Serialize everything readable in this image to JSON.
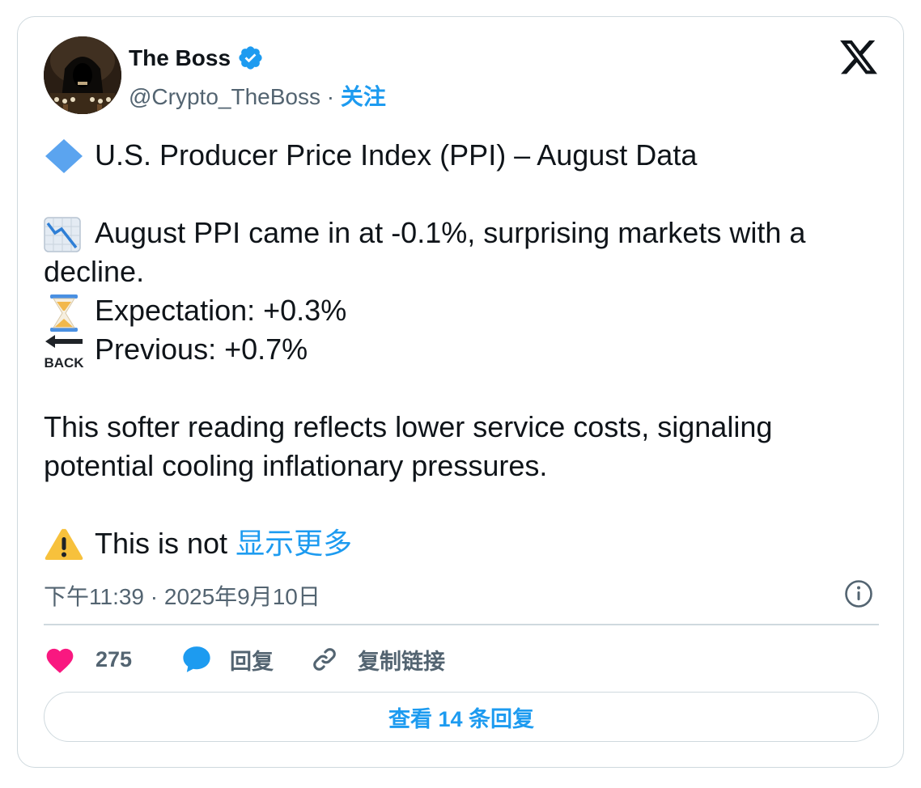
{
  "author": {
    "name": "The Boss",
    "handle": "@Crypto_TheBoss",
    "separator": " · ",
    "follow_label": "关注"
  },
  "tweet": {
    "title": "U.S. Producer Price Index (PPI) – August Data",
    "line1": "August PPI came in at -0.1%, surprising markets with a decline.",
    "expectation": "Expectation: +0.3%",
    "previous": "Previous: +0.7%",
    "paragraph": "This softer reading reflects lower service costs, signaling potential cooling inflationary pressures.",
    "warning_text": "This is not ",
    "show_more_label": "显示更多",
    "back_emoji_text": "BACK"
  },
  "meta": {
    "timestamp": "下午11:39 · 2025年9月10日"
  },
  "actions": {
    "likes_count": "275",
    "reply_label": "回复",
    "copy_link_label": "复制链接"
  },
  "view_replies_label": "查看 14 条回复",
  "colors": {
    "accent": "#1d9bf0",
    "heart": "#f91880",
    "text": "#0f1419",
    "muted": "#536471",
    "border": "#cfd9de"
  },
  "icons": [
    "verified-badge-icon",
    "x-logo-icon",
    "diamond-icon",
    "chart-down-icon",
    "hourglass-icon",
    "back-arrow-icon",
    "warning-icon",
    "info-icon",
    "heart-icon",
    "reply-bubble-icon",
    "link-icon"
  ]
}
